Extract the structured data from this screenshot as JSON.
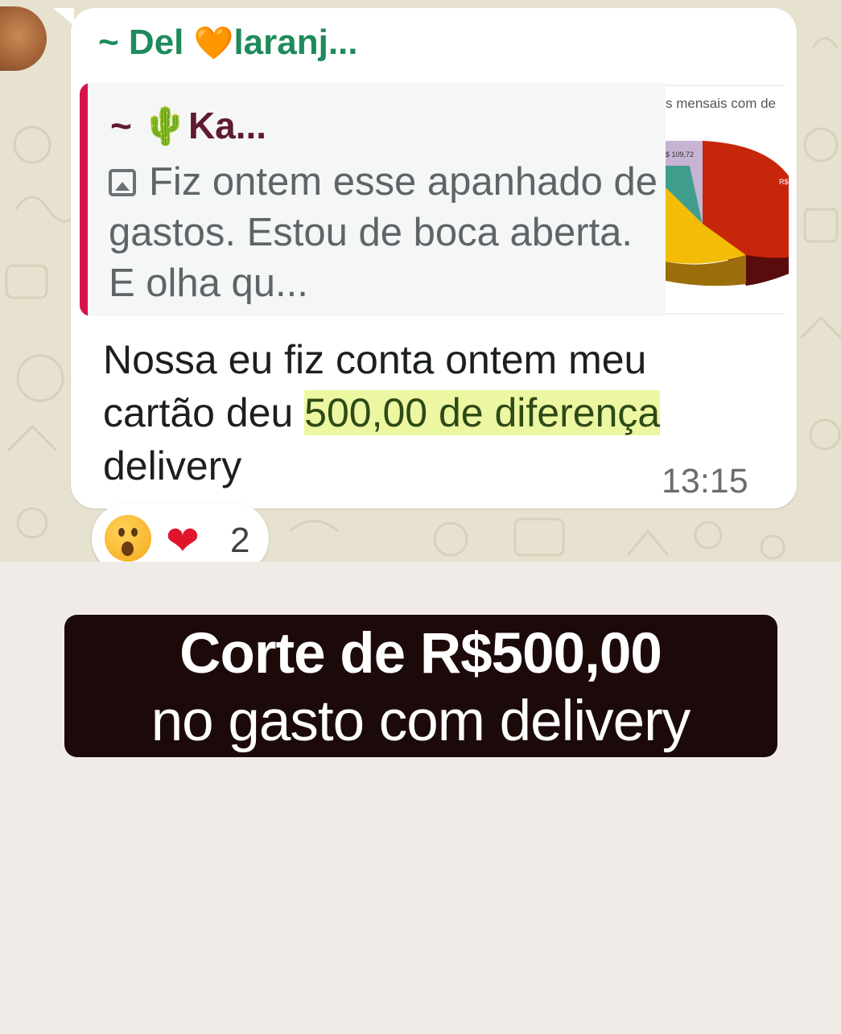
{
  "chat": {
    "sender": "~ Del ",
    "sender_heart": "🧡",
    "sender_rest": "laranj...",
    "quote": {
      "author_prefix": "~ ",
      "author_cactus": "🌵",
      "author_name": "Ka...",
      "text": "Fiz ontem esse apanhado de gastos. Estou de boca aberta. E olha qu...",
      "thumbnail": {
        "caption": "s mensais com de",
        "label_value": "$ 109,72",
        "label_right": "R$"
      }
    },
    "message": {
      "text_before": "Nossa eu fiz conta ontem meu cartão deu ",
      "highlight": "500,00 de diferença ",
      "text_after": " delivery",
      "time": "13:15"
    },
    "reactions": {
      "emoji_1": "😮",
      "emoji_2": "❤",
      "count": "2"
    }
  },
  "caption": {
    "line1": "Corte de R$500,00",
    "line2": "no gasto com delivery"
  },
  "colors": {
    "chat_background": "#e6e2cf",
    "bubble": "#ffffff",
    "sender_green": "#1f8a5b",
    "quote_bar": "#d6134d",
    "highlight": "#edf7a2",
    "caption_box": "#1c0a0b",
    "page_background": "#f0ebe6"
  }
}
